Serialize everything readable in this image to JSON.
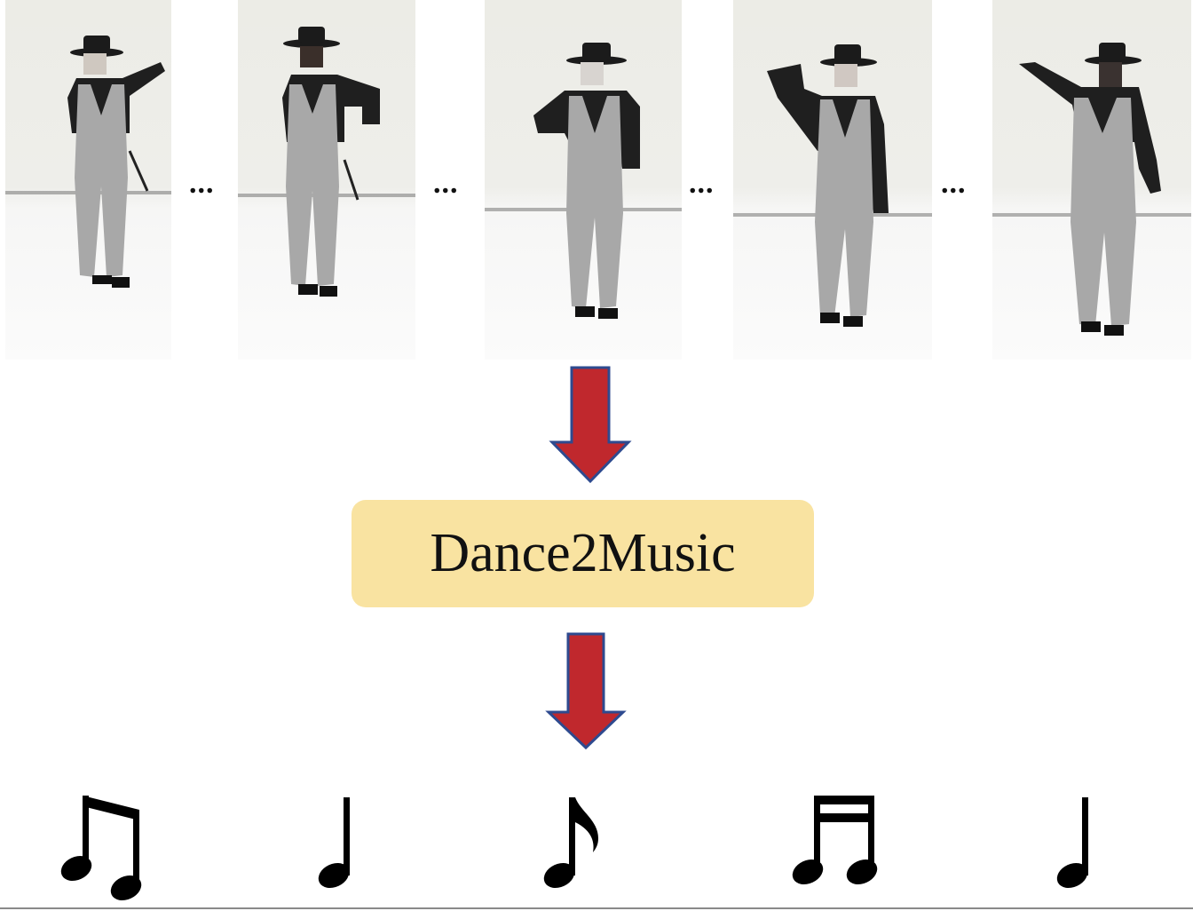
{
  "frames": [
    {
      "label": "dance-frame-1",
      "pose": "right-arm-raised"
    },
    {
      "label": "dance-frame-2",
      "pose": "arm-across-chest"
    },
    {
      "label": "dance-frame-3",
      "pose": "hand-near-face"
    },
    {
      "label": "dance-frame-4",
      "pose": "arm-overhead"
    },
    {
      "label": "dance-frame-5",
      "pose": "arm-extended"
    }
  ],
  "ellipsis": "...",
  "model": {
    "label": "Dance2Music"
  },
  "colors": {
    "arrow_fill": "#c0282d",
    "arrow_stroke": "#2e4a8f",
    "box_fill": "#f9e3a1",
    "note": "#000000"
  },
  "notes": [
    {
      "icon": "beamed-eighth-notes-icon"
    },
    {
      "icon": "quarter-note-icon"
    },
    {
      "icon": "eighth-note-icon"
    },
    {
      "icon": "beamed-sixteenth-notes-icon"
    },
    {
      "icon": "quarter-note-icon"
    }
  ]
}
